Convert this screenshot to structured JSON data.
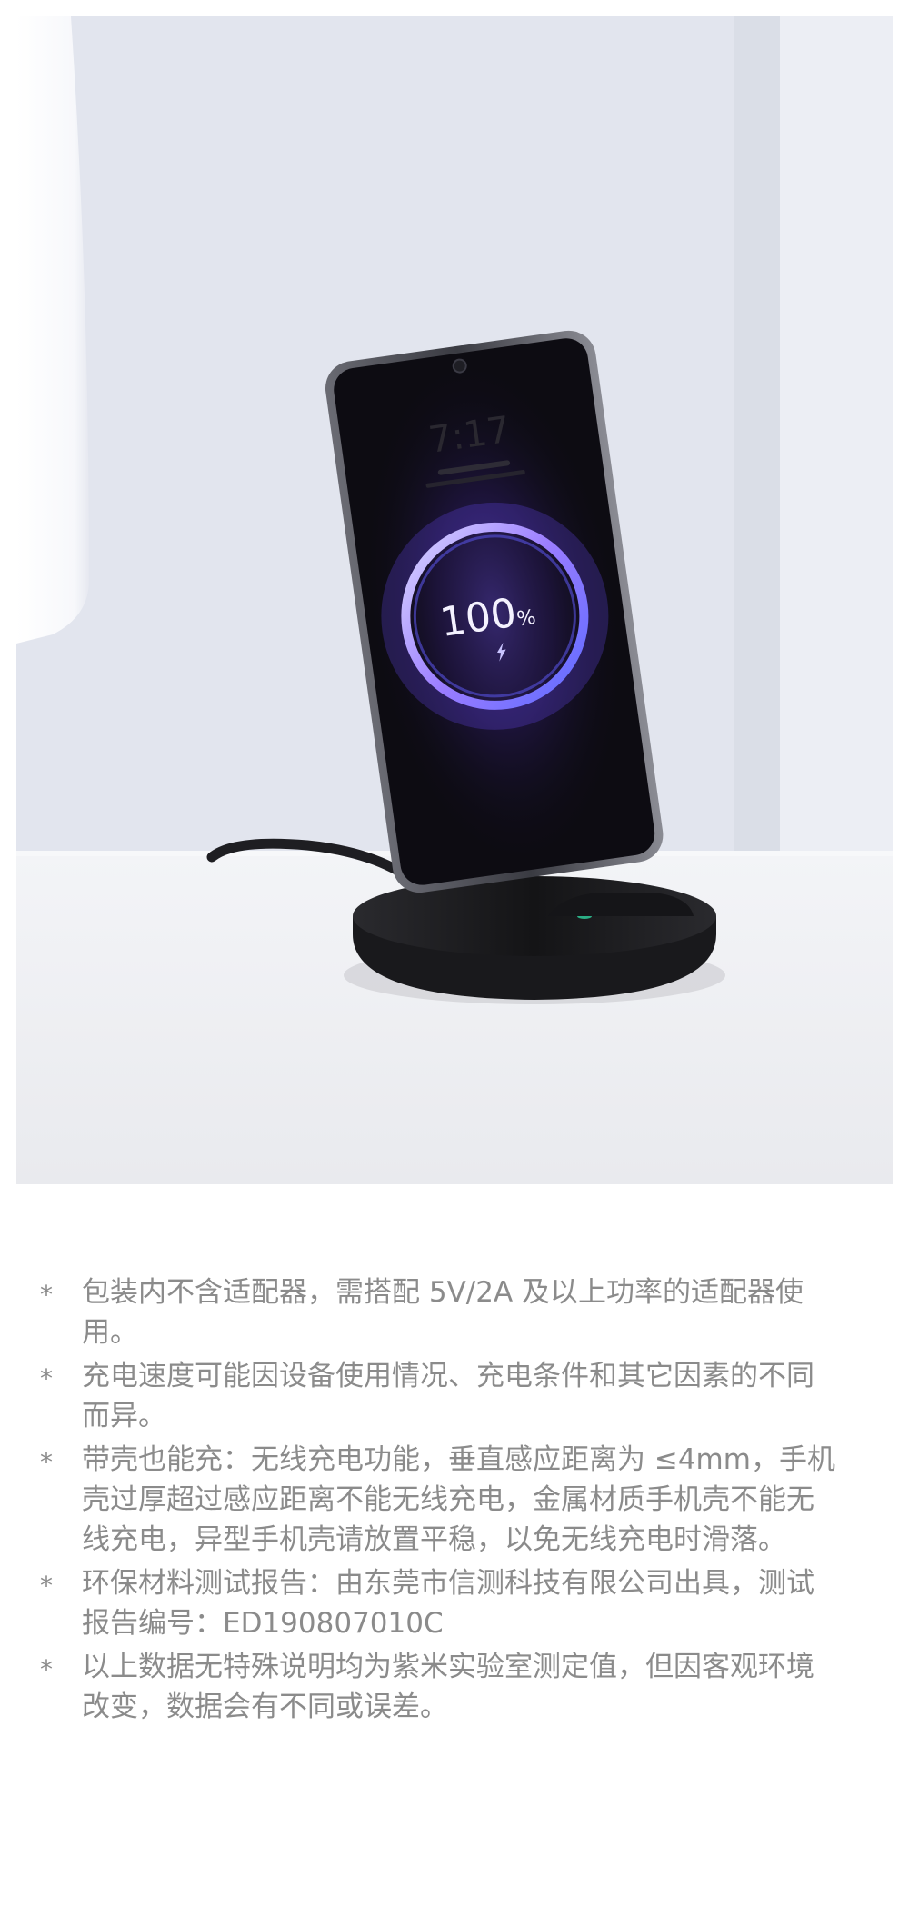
{
  "hero": {
    "image_alt": "Wireless charging stand with phone",
    "screen_time": "7:17",
    "charge_value": "100",
    "charge_unit": "%"
  },
  "notes": [
    {
      "bullet": "*",
      "text": "包装内不含适配器，需搭配 5V/2A 及以上功率的适配器使用。"
    },
    {
      "bullet": "*",
      "text": "充电速度可能因设备使用情况、充电条件和其它因素的不同而异。"
    },
    {
      "bullet": "*",
      "text": "带壳也能充：无线充电功能，垂直感应距离为 ≤4mm，手机壳过厚超过感应距离不能无线充电，金属材质手机壳不能无线充电，异型手机壳请放置平稳，以免无线充电时滑落。"
    },
    {
      "bullet": "*",
      "text": "环保材料测试报告：由东莞市信测科技有限公司出具，测试报告编号：ED190807010C"
    },
    {
      "bullet": "*",
      "text": "以上数据无特殊说明均为紫米实验室测定值，但因客观环境改变，数据会有不同或误差。"
    }
  ],
  "colors": {
    "background": "#ffffff",
    "note_text": "#8b8b8b",
    "wall": "#e2e5ee",
    "ring_accent": "#8a7cff",
    "stand": "#1b1b1e"
  }
}
